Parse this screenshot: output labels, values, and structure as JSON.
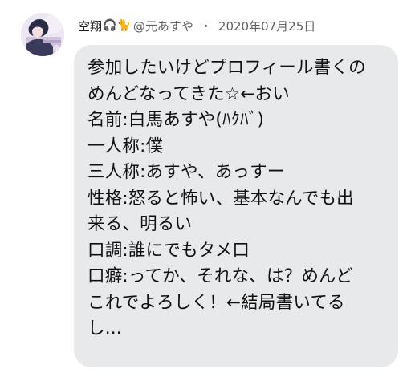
{
  "post": {
    "author_name": "空翔",
    "author_emoji": "🎧🐈",
    "handle": "@元あすや",
    "separator": "・",
    "date": "2020年07月25日",
    "avatar_icon": "profile-avatar",
    "body_lines": [
      "参加したいけどプロフィール書くの",
      "めんどなってきた☆←おい",
      "名前:白馬あすや(ﾊｸﾊﾞ)",
      "一人称:僕",
      "三人称:あすや、あっすー",
      "性格:怒ると怖い、基本なんでも出",
      "来る、明るい",
      "口調:誰にでもタメ口",
      "口癖:ってか、それな、は？めんど",
      "これでよろしく！←結局書いてる",
      "し..."
    ]
  },
  "colors": {
    "bubble_bg": "#e8e9eb",
    "meta_text": "#5f6267",
    "body_text": "#111111"
  }
}
